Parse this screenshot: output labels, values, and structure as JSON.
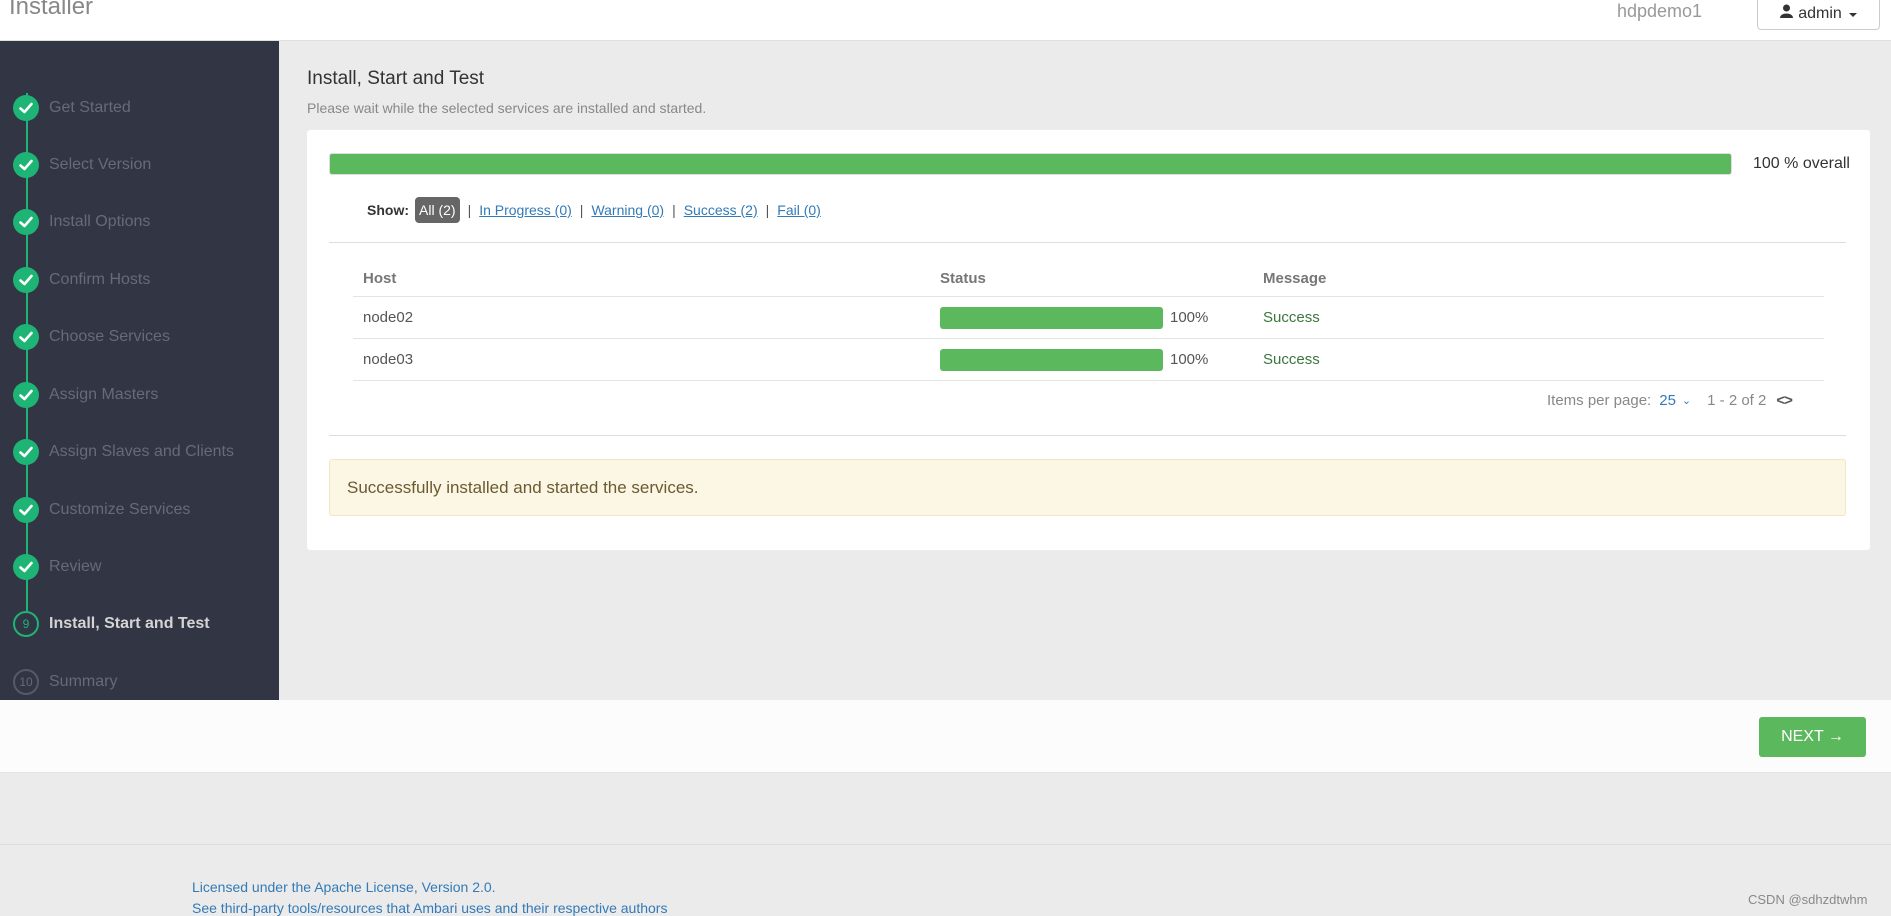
{
  "header": {
    "app_title": "Installer",
    "cluster_name": "hdpdemo1",
    "user": "admin"
  },
  "sidebar": {
    "steps": [
      {
        "label": "Get Started",
        "state": "done"
      },
      {
        "label": "Select Version",
        "state": "done"
      },
      {
        "label": "Install Options",
        "state": "done"
      },
      {
        "label": "Confirm Hosts",
        "state": "done"
      },
      {
        "label": "Choose Services",
        "state": "done"
      },
      {
        "label": "Assign Masters",
        "state": "done"
      },
      {
        "label": "Assign Slaves and Clients",
        "state": "done"
      },
      {
        "label": "Customize Services",
        "state": "done"
      },
      {
        "label": "Review",
        "state": "done"
      },
      {
        "label": "Install, Start and Test",
        "state": "active",
        "number": "9"
      },
      {
        "label": "Summary",
        "state": "todo",
        "number": "10"
      }
    ]
  },
  "main": {
    "title": "Install, Start and Test",
    "subtitle": "Please wait while the selected services are installed and started.",
    "overall_progress": 100,
    "overall_text": "100 % overall",
    "filters": {
      "show_label": "Show:",
      "all": "All (2)",
      "in_progress": "In Progress (0)",
      "warning": "Warning (0)",
      "success": "Success (2)",
      "fail": "Fail (0)"
    },
    "table": {
      "headers": {
        "host": "Host",
        "status": "Status",
        "message": "Message"
      },
      "rows": [
        {
          "host": "node02",
          "progress": 100,
          "percent": "100%",
          "message": "Success"
        },
        {
          "host": "node03",
          "progress": 100,
          "percent": "100%",
          "message": "Success"
        }
      ]
    },
    "pagination": {
      "items_per_page_label": "Items per page:",
      "items_per_page": "25",
      "range": "1 - 2 of 2"
    },
    "alert": "Successfully installed and started the services."
  },
  "actions": {
    "next": "NEXT →"
  },
  "footer": {
    "license": "Licensed under the Apache License, Version 2.0.",
    "third_party": "See third-party tools/resources that Ambari uses and their respective authors"
  },
  "watermark": "CSDN @sdhzdtwhm",
  "colors": {
    "success_green": "#5cb85c",
    "step_green": "#1eb475",
    "sidebar_bg": "#323544",
    "link_blue": "#337ab7"
  }
}
